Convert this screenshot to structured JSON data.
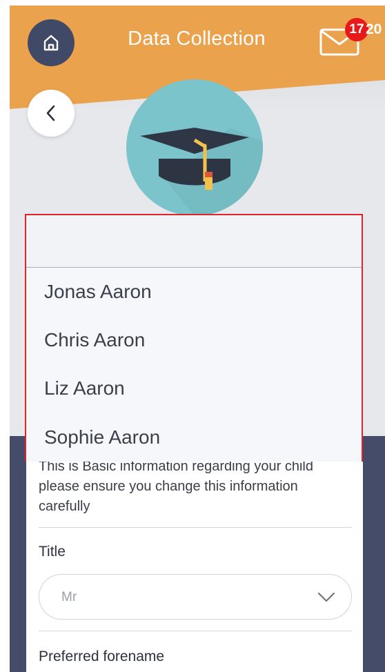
{
  "header": {
    "title": "Data Collection",
    "badge_count": "17",
    "badge_extra": "20"
  },
  "colors": {
    "header_orange": "#eba24c",
    "nav_circle": "#404a67",
    "badge_red": "#e81919",
    "avatar_teal": "#7cc4cb",
    "dropdown_highlight": "#e0232b"
  },
  "icons": {
    "home": "home-icon",
    "mail": "mail-icon",
    "back": "chevron-left-icon",
    "avatar": "graduation-cap-icon",
    "select": "chevron-down-icon"
  },
  "dropdown": {
    "selected": "",
    "options": [
      "Jonas Aaron",
      "Chris Aaron",
      "Liz Aaron",
      "Sophie Aaron"
    ]
  },
  "form": {
    "info_text": "This is Basic information regarding your child please ensure you change this information carefully",
    "title_label": "Title",
    "title_value": "Mr",
    "preferred_forename_label": "Preferred forename"
  }
}
